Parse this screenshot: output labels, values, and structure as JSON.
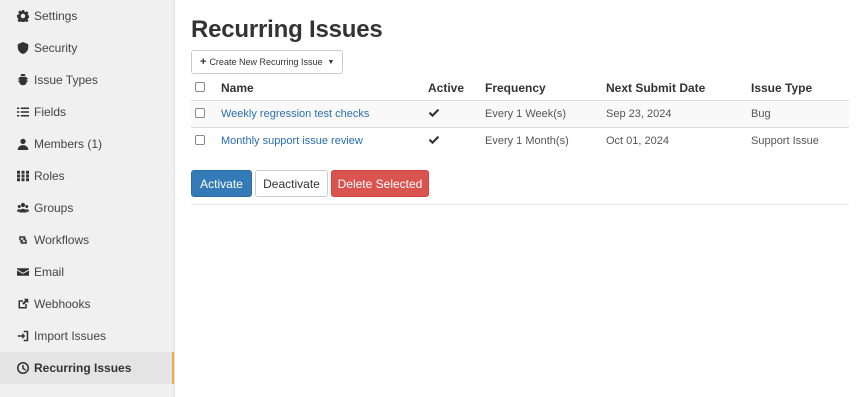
{
  "sidebar": {
    "items": [
      {
        "label": "Settings",
        "icon": "gear-icon"
      },
      {
        "label": "Security",
        "icon": "shield-icon"
      },
      {
        "label": "Issue Types",
        "icon": "bug-icon"
      },
      {
        "label": "Fields",
        "icon": "list-icon"
      },
      {
        "label": "Members (1)",
        "icon": "user-icon"
      },
      {
        "label": "Roles",
        "icon": "grid-icon"
      },
      {
        "label": "Groups",
        "icon": "users-icon"
      },
      {
        "label": "Workflows",
        "icon": "retweet-icon"
      },
      {
        "label": "Email",
        "icon": "envelope-icon"
      },
      {
        "label": "Webhooks",
        "icon": "external-link-icon"
      },
      {
        "label": "Import Issues",
        "icon": "import-icon"
      },
      {
        "label": "Recurring Issues",
        "icon": "clock-icon",
        "active": true
      }
    ]
  },
  "main": {
    "title": "Recurring Issues",
    "create_button": "Create New Recurring Issue",
    "table": {
      "headers": {
        "name": "Name",
        "active": "Active",
        "frequency": "Frequency",
        "next_submit_date": "Next Submit Date",
        "issue_type": "Issue Type"
      },
      "rows": [
        {
          "name": "Weekly regression test checks",
          "active": true,
          "frequency": "Every 1 Week(s)",
          "next_submit_date": "Sep 23, 2024",
          "issue_type": "Bug"
        },
        {
          "name": "Monthly support issue review",
          "active": true,
          "frequency": "Every 1 Month(s)",
          "next_submit_date": "Oct 01, 2024",
          "issue_type": "Support Issue"
        }
      ]
    },
    "actions": {
      "activate": "Activate",
      "deactivate": "Deactivate",
      "delete_selected": "Delete Selected"
    }
  },
  "colors": {
    "primary": "#337ab7",
    "danger": "#d9534f",
    "link": "#2a6fb0",
    "active_indicator": "#f0a64b"
  }
}
